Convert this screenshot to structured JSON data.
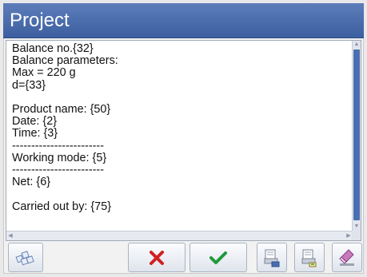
{
  "window": {
    "title": "Project"
  },
  "editor": {
    "lines": [
      "Balance no.{32}",
      "Balance parameters:",
      "Max = 220 g",
      "d={33}",
      "",
      "Product name: {50}",
      "Date: {2}",
      "Time: {3}",
      "------------------------",
      "Working mode: {5}",
      "------------------------",
      "Net: {6}",
      "",
      "Carried out by: {75}"
    ]
  },
  "toolbar": {
    "buttons": [
      {
        "icon": "variables-icon",
        "color": "#6c86b8"
      },
      {
        "icon": "cancel-icon",
        "color": "#d02020"
      },
      {
        "icon": "confirm-icon",
        "color": "#1f9a3a"
      },
      {
        "icon": "print-to-pc-icon",
        "color": "#4a6fb0"
      },
      {
        "icon": "import-template-icon",
        "color": "#3a9a3a"
      },
      {
        "icon": "clear-eraser-icon",
        "color": "#8a3a8a"
      }
    ]
  }
}
